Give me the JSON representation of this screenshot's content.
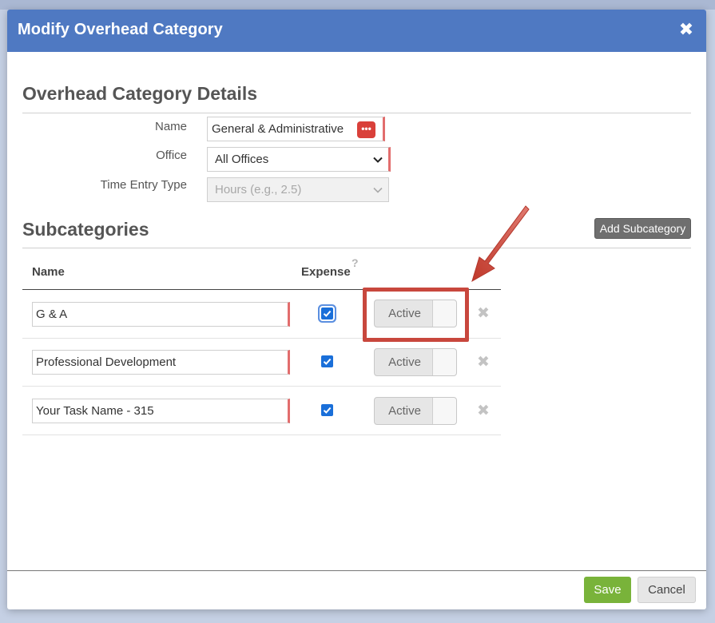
{
  "modal": {
    "title": "Modify Overhead Category",
    "close_glyph": "✖"
  },
  "details": {
    "section_title": "Overhead Category Details",
    "name_label": "Name",
    "name_value": "General & Administrative",
    "office_label": "Office",
    "office_value": "All Offices",
    "time_entry_label": "Time Entry Type",
    "time_entry_placeholder": "Hours (e.g., 2.5)"
  },
  "subcategories": {
    "section_title": "Subcategories",
    "add_button": "Add Subcategory",
    "col_name": "Name",
    "col_expense": "Expense",
    "help_glyph": "?",
    "rows": [
      {
        "name": "G & A",
        "expense": true,
        "status": "Active"
      },
      {
        "name": "Professional Development",
        "expense": true,
        "status": "Active"
      },
      {
        "name": "Your Task Name - 315",
        "expense": true,
        "status": "Active"
      }
    ]
  },
  "footer": {
    "save": "Save",
    "cancel": "Cancel"
  },
  "colors": {
    "header": "#4f79c2",
    "save": "#79b33a",
    "highlight": "#c8473d"
  },
  "icons": [
    "close-icon",
    "password-manager-icon",
    "chevron-down-icon",
    "help-icon",
    "checkbox-checked-icon",
    "delete-icon",
    "annotation-arrow-icon"
  ]
}
